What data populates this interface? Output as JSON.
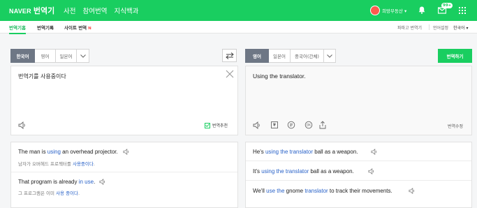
{
  "header": {
    "logo": "NAVER",
    "service": "번역기",
    "menu": [
      "사전",
      "참여번역",
      "지식백과"
    ],
    "username": "희망부동산 ▾",
    "mail_badge": "99+"
  },
  "subnav": {
    "tabs": [
      "번역기홈",
      "번역기록",
      "사이트 번역"
    ],
    "new_mark": "N",
    "right_links": [
      "파파고 번역기",
      "언어설정",
      "한국어 ▾"
    ]
  },
  "source": {
    "langs": [
      "한국어",
      "영어",
      "일본어"
    ],
    "text": "번역기를 사용중이다",
    "recommend_label": "번역추천"
  },
  "target": {
    "langs": [
      "영어",
      "일본어",
      "중국어(간체)"
    ],
    "text": "Using the translator.",
    "translate_button": "번역하기",
    "edit_label": "번역수정"
  },
  "examples_left": [
    {
      "en_pre": "The man is ",
      "en_hl": "using",
      "en_post": " an overhead projector.",
      "ko_pre": "남자가 오버헤드 프로젝터를 ",
      "ko_hl": "사용중이다",
      "ko_post": "."
    },
    {
      "en_pre": "That program is already ",
      "en_hl": "in use",
      "en_post": ".",
      "ko_pre": "그 프로그램은 이미 ",
      "ko_hl": "사용 중이다",
      "ko_post": "."
    }
  ],
  "examples_right": [
    {
      "pre": "He's ",
      "hl": "using the translator",
      "post": " ball as a weapon."
    },
    {
      "pre": "It's ",
      "hl": "using the translator",
      "post": " ball as a weapon."
    },
    {
      "pre": "We'll ",
      "hl": "use the",
      "mid": " gnome ",
      "hl2": "translator",
      "post": " to track their movements."
    }
  ]
}
